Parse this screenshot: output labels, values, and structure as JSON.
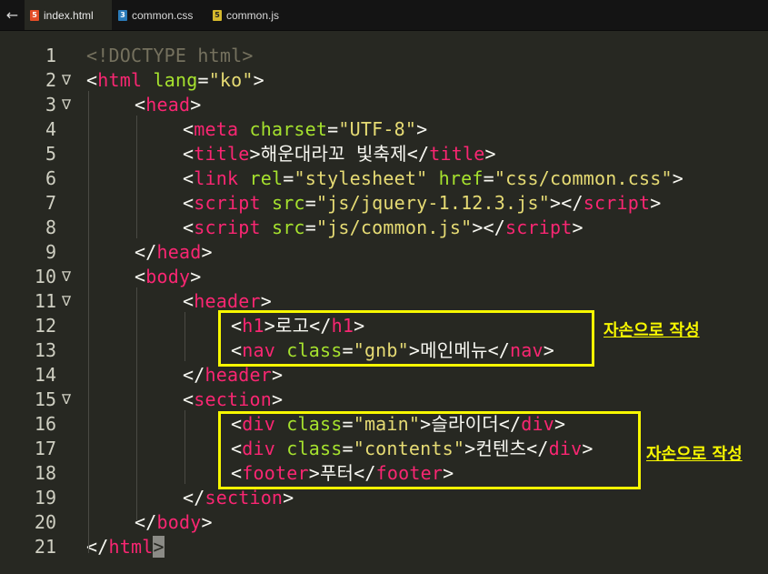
{
  "tabs": [
    {
      "label": "index.html",
      "icon": "html-file-icon",
      "icon_glyph": "5",
      "icon_color": "#e44d26",
      "active": true
    },
    {
      "label": "common.css",
      "icon": "css-file-icon",
      "icon_glyph": "3",
      "icon_color": "#2a7ab8",
      "active": false
    },
    {
      "label": "common.js",
      "icon": "js-file-icon",
      "icon_glyph": "5",
      "icon_color": "#d4b82c",
      "active": false
    }
  ],
  "back_icon": "←",
  "fold_icon": "∇",
  "editor": {
    "lines": [
      {
        "num": "1",
        "fold": false,
        "indent": 0,
        "tokens": [
          [
            "doct",
            "<!DOCTYPE html>"
          ]
        ]
      },
      {
        "num": "2",
        "fold": true,
        "indent": 0,
        "tokens": [
          [
            "pun",
            "<"
          ],
          [
            "tag",
            "html"
          ],
          [
            "pun",
            " "
          ],
          [
            "attr",
            "lang"
          ],
          [
            "pun",
            "="
          ],
          [
            "str",
            "\"ko\""
          ],
          [
            "pun",
            ">"
          ]
        ]
      },
      {
        "num": "3",
        "fold": true,
        "indent": 1,
        "tokens": [
          [
            "pun",
            "<"
          ],
          [
            "tag",
            "head"
          ],
          [
            "pun",
            ">"
          ]
        ]
      },
      {
        "num": "4",
        "fold": false,
        "indent": 2,
        "tokens": [
          [
            "pun",
            "<"
          ],
          [
            "tag",
            "meta"
          ],
          [
            "pun",
            " "
          ],
          [
            "attr",
            "charset"
          ],
          [
            "pun",
            "="
          ],
          [
            "str",
            "\"UTF-8\""
          ],
          [
            "pun",
            ">"
          ]
        ]
      },
      {
        "num": "5",
        "fold": false,
        "indent": 2,
        "tokens": [
          [
            "pun",
            "<"
          ],
          [
            "tag",
            "title"
          ],
          [
            "pun",
            ">해운대라꼬 빛축제</"
          ],
          [
            "tag",
            "title"
          ],
          [
            "pun",
            ">"
          ]
        ]
      },
      {
        "num": "6",
        "fold": false,
        "indent": 2,
        "tokens": [
          [
            "pun",
            "<"
          ],
          [
            "tag",
            "link"
          ],
          [
            "pun",
            " "
          ],
          [
            "attr",
            "rel"
          ],
          [
            "pun",
            "="
          ],
          [
            "str",
            "\"stylesheet\""
          ],
          [
            "pun",
            " "
          ],
          [
            "attr",
            "href"
          ],
          [
            "pun",
            "="
          ],
          [
            "str",
            "\"css/common.css\""
          ],
          [
            "pun",
            ">"
          ]
        ]
      },
      {
        "num": "7",
        "fold": false,
        "indent": 2,
        "tokens": [
          [
            "pun",
            "<"
          ],
          [
            "tag",
            "script"
          ],
          [
            "pun",
            " "
          ],
          [
            "attr",
            "src"
          ],
          [
            "pun",
            "="
          ],
          [
            "str",
            "\"js/jquery-1.12.3.js\""
          ],
          [
            "pun",
            "></"
          ],
          [
            "tag",
            "script"
          ],
          [
            "pun",
            ">"
          ]
        ]
      },
      {
        "num": "8",
        "fold": false,
        "indent": 2,
        "tokens": [
          [
            "pun",
            "<"
          ],
          [
            "tag",
            "script"
          ],
          [
            "pun",
            " "
          ],
          [
            "attr",
            "src"
          ],
          [
            "pun",
            "="
          ],
          [
            "str",
            "\"js/common.js\""
          ],
          [
            "pun",
            "></"
          ],
          [
            "tag",
            "script"
          ],
          [
            "pun",
            ">"
          ]
        ]
      },
      {
        "num": "9",
        "fold": false,
        "indent": 1,
        "tokens": [
          [
            "pun",
            "</"
          ],
          [
            "tag",
            "head"
          ],
          [
            "pun",
            ">"
          ]
        ]
      },
      {
        "num": "10",
        "fold": true,
        "indent": 1,
        "tokens": [
          [
            "pun",
            "<"
          ],
          [
            "tag",
            "body"
          ],
          [
            "pun",
            ">"
          ]
        ]
      },
      {
        "num": "11",
        "fold": true,
        "indent": 2,
        "tokens": [
          [
            "pun",
            "<"
          ],
          [
            "tag",
            "header"
          ],
          [
            "pun",
            ">"
          ]
        ]
      },
      {
        "num": "12",
        "fold": false,
        "indent": 3,
        "tokens": [
          [
            "pun",
            "<"
          ],
          [
            "tag",
            "h1"
          ],
          [
            "pun",
            ">로고</"
          ],
          [
            "tag",
            "h1"
          ],
          [
            "pun",
            ">"
          ]
        ]
      },
      {
        "num": "13",
        "fold": false,
        "indent": 3,
        "tokens": [
          [
            "pun",
            "<"
          ],
          [
            "tag",
            "nav"
          ],
          [
            "pun",
            " "
          ],
          [
            "attr",
            "class"
          ],
          [
            "pun",
            "="
          ],
          [
            "str",
            "\"gnb\""
          ],
          [
            "pun",
            ">메인메뉴</"
          ],
          [
            "tag",
            "nav"
          ],
          [
            "pun",
            ">"
          ]
        ]
      },
      {
        "num": "14",
        "fold": false,
        "indent": 2,
        "tokens": [
          [
            "pun",
            "</"
          ],
          [
            "tag",
            "header"
          ],
          [
            "pun",
            ">"
          ]
        ]
      },
      {
        "num": "15",
        "fold": true,
        "indent": 2,
        "tokens": [
          [
            "pun",
            "<"
          ],
          [
            "tag",
            "section"
          ],
          [
            "pun",
            ">"
          ]
        ]
      },
      {
        "num": "16",
        "fold": false,
        "indent": 3,
        "tokens": [
          [
            "pun",
            "<"
          ],
          [
            "tag",
            "div"
          ],
          [
            "pun",
            " "
          ],
          [
            "attr",
            "class"
          ],
          [
            "pun",
            "="
          ],
          [
            "str",
            "\"main\""
          ],
          [
            "pun",
            ">슬라이더</"
          ],
          [
            "tag",
            "div"
          ],
          [
            "pun",
            ">"
          ]
        ]
      },
      {
        "num": "17",
        "fold": false,
        "indent": 3,
        "tokens": [
          [
            "pun",
            "<"
          ],
          [
            "tag",
            "div"
          ],
          [
            "pun",
            " "
          ],
          [
            "attr",
            "class"
          ],
          [
            "pun",
            "="
          ],
          [
            "str",
            "\"contents\""
          ],
          [
            "pun",
            ">컨텐츠</"
          ],
          [
            "tag",
            "div"
          ],
          [
            "pun",
            ">"
          ]
        ]
      },
      {
        "num": "18",
        "fold": false,
        "indent": 3,
        "tokens": [
          [
            "pun",
            "<"
          ],
          [
            "tag",
            "footer"
          ],
          [
            "pun",
            ">푸터</"
          ],
          [
            "tag",
            "footer"
          ],
          [
            "pun",
            ">"
          ]
        ]
      },
      {
        "num": "19",
        "fold": false,
        "indent": 2,
        "tokens": [
          [
            "pun",
            "</"
          ],
          [
            "tag",
            "section"
          ],
          [
            "pun",
            ">"
          ]
        ]
      },
      {
        "num": "20",
        "fold": false,
        "indent": 1,
        "tokens": [
          [
            "pun",
            "</"
          ],
          [
            "tag",
            "body"
          ],
          [
            "pun",
            ">"
          ]
        ]
      },
      {
        "num": "21",
        "fold": false,
        "indent": 0,
        "tokens": [
          [
            "pun",
            "</"
          ],
          [
            "tag",
            "html"
          ],
          [
            "hl",
            ">"
          ]
        ]
      }
    ]
  },
  "annotations": [
    "자손으로 작성",
    "자손으로 작성"
  ],
  "colors": {
    "annotation": "#f7f700",
    "background": "#272822"
  }
}
